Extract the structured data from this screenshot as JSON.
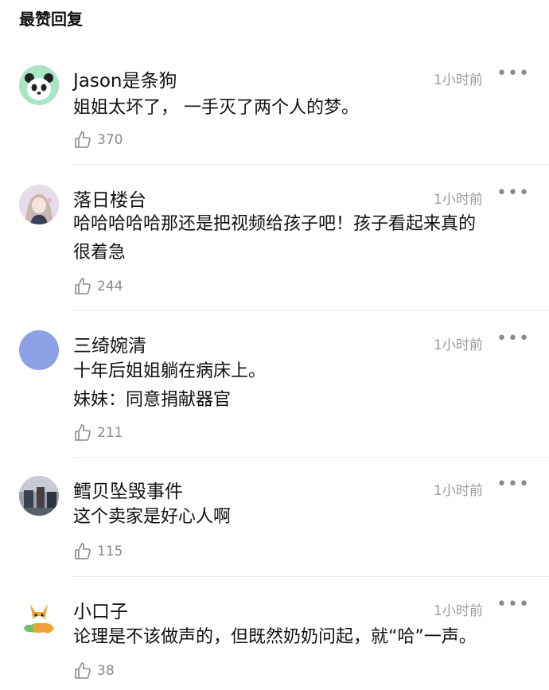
{
  "header": {
    "title": "最赞回复"
  },
  "comments": [
    {
      "name": "Jason是条狗",
      "time": "1小时前",
      "more": "•••",
      "lines": [
        "姐姐太坏了， 一手灭了两个人的梦。"
      ],
      "likes": "370",
      "avatar": "panda"
    },
    {
      "name": "落日楼台",
      "time": "1小时前",
      "more": "•••",
      "lines": [
        "哈哈哈哈哈那还是把视频给孩子吧！孩子看起来真的",
        "很着急"
      ],
      "likes": "244",
      "avatar": "girl"
    },
    {
      "name": "三绮婉清",
      "time": "1小时前",
      "more": "•••",
      "lines": [
        "十年后姐姐躺在病床上。",
        "妹妹：同意捐献器官"
      ],
      "likes": "211",
      "avatar": "purple"
    },
    {
      "name": "鳕贝坠毁事件",
      "time": "1小时前",
      "more": "•••",
      "lines": [
        "这个卖家是好心人啊"
      ],
      "likes": "115",
      "avatar": "photo"
    },
    {
      "name": "小口子",
      "time": "1小时前",
      "more": "•••",
      "lines": [
        "论理是不该做声的，但既然奶奶问起，就“哈”一声。"
      ],
      "likes": "38",
      "avatar": "fox"
    }
  ]
}
